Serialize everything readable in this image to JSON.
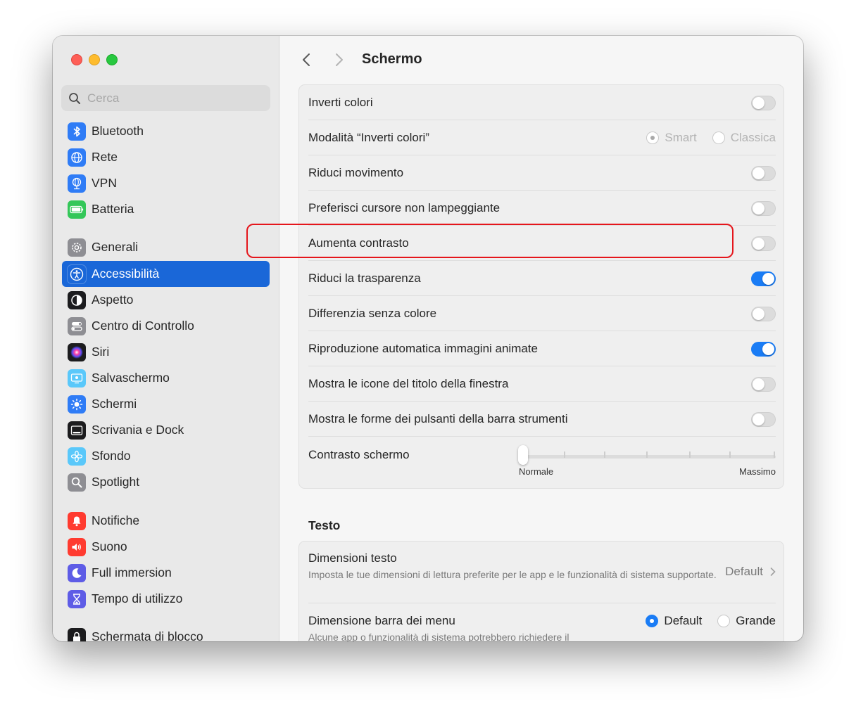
{
  "window": {
    "traffic_lights": [
      "close",
      "minimize",
      "zoom"
    ]
  },
  "sidebar": {
    "search_placeholder": "Cerca",
    "groups": [
      [
        {
          "label": "Bluetooth",
          "icon": "bluetooth-icon",
          "color": "#2f7cf6"
        },
        {
          "label": "Rete",
          "icon": "globe-icon",
          "color": "#2f7cf6"
        },
        {
          "label": "VPN",
          "icon": "vpn-globe-icon",
          "color": "#2f7cf6"
        },
        {
          "label": "Batteria",
          "icon": "battery-icon",
          "color": "#34c759"
        }
      ],
      [
        {
          "label": "Generali",
          "icon": "gear-icon",
          "color": "#8e8e93"
        },
        {
          "label": "Accessibilità",
          "icon": "accessibility-icon",
          "color": "#1a67d8",
          "active": true
        },
        {
          "label": "Aspetto",
          "icon": "appearance-icon",
          "color": "#1c1c1e"
        },
        {
          "label": "Centro di Controllo",
          "icon": "control-center-icon",
          "color": "#8e8e93"
        },
        {
          "label": "Siri",
          "icon": "siri-icon",
          "color": "#6b2fd6"
        },
        {
          "label": "Salvaschermo",
          "icon": "screensaver-icon",
          "color": "#5ac8fa"
        },
        {
          "label": "Schermi",
          "icon": "brightness-icon",
          "color": "#2f7cf6"
        },
        {
          "label": "Scrivania e Dock",
          "icon": "dock-icon",
          "color": "#1c1c1e"
        },
        {
          "label": "Sfondo",
          "icon": "wallpaper-flower-icon",
          "color": "#5ac8fa"
        },
        {
          "label": "Spotlight",
          "icon": "magnifier-icon",
          "color": "#8e8e93"
        }
      ],
      [
        {
          "label": "Notifiche",
          "icon": "bell-icon",
          "color": "#ff3b30"
        },
        {
          "label": "Suono",
          "icon": "speaker-icon",
          "color": "#ff3b30"
        },
        {
          "label": "Full immersion",
          "icon": "moon-icon",
          "color": "#5e5ce6"
        },
        {
          "label": "Tempo di utilizzo",
          "icon": "hourglass-icon",
          "color": "#5e5ce6"
        }
      ],
      [
        {
          "label": "Schermata di blocco",
          "icon": "lock-icon",
          "color": "#1c1c1e"
        }
      ]
    ]
  },
  "main": {
    "title": "Schermo",
    "settings": [
      {
        "label": "Inverti colori",
        "type": "toggle",
        "on": false
      },
      {
        "label": "Modalità “Inverti colori”",
        "type": "radio",
        "options": [
          "Smart",
          "Classica"
        ],
        "selected": "Smart",
        "disabled": true
      },
      {
        "label": "Riduci movimento",
        "type": "toggle",
        "on": false
      },
      {
        "label": "Preferisci cursore non lampeggiante",
        "type": "toggle",
        "on": false
      },
      {
        "label": "Aumenta contrasto",
        "type": "toggle",
        "on": false
      },
      {
        "label": "Riduci la trasparenza",
        "type": "toggle",
        "on": true,
        "highlighted": true
      },
      {
        "label": "Differenzia senza colore",
        "type": "toggle",
        "on": false
      },
      {
        "label": "Riproduzione automatica immagini animate",
        "type": "toggle",
        "on": true
      },
      {
        "label": "Mostra le icone del titolo della finestra",
        "type": "toggle",
        "on": false
      },
      {
        "label": "Mostra le forme dei pulsanti della barra strumenti",
        "type": "toggle",
        "on": false
      }
    ],
    "contrast": {
      "label": "Contrasto schermo",
      "min_label": "Normale",
      "max_label": "Massimo",
      "value": 0
    },
    "text_section": {
      "title": "Testo",
      "text_size": {
        "label": "Dimensioni testo",
        "description": "Imposta le tue dimensioni di lettura preferite per le app e le funzionalità di sistema supportate.",
        "value": "Default"
      },
      "menu_bar_size": {
        "label": "Dimensione barra dei menu",
        "description": "Alcune app o funzionalità di sistema potrebbero richiedere il",
        "options": [
          "Default",
          "Grande"
        ],
        "selected": "Default"
      }
    }
  },
  "colors": {
    "accent": "#1a67d8",
    "toggle_on": "#1a7cf5",
    "highlight": "#e5161c"
  }
}
